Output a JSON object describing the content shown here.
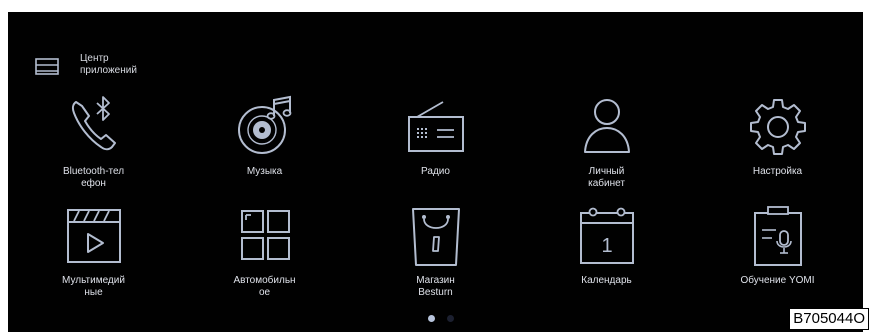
{
  "header": {
    "title": "Центр\nприложений",
    "icon": "app-center-icon"
  },
  "apps": [
    {
      "label": "Bluetooth-тел\nефон",
      "icon": "bluetooth-phone-icon"
    },
    {
      "label": "Музыка",
      "icon": "music-disc-icon"
    },
    {
      "label": "Радио",
      "icon": "radio-icon"
    },
    {
      "label": "Личный\nкабинет",
      "icon": "user-profile-icon"
    },
    {
      "label": "Настройка",
      "icon": "gear-icon"
    },
    {
      "label": "Мультимедий\nные",
      "icon": "video-clapper-icon"
    },
    {
      "label": "Автомобильн\nое",
      "icon": "grid-icon"
    },
    {
      "label": "Магазин\nBesturn",
      "icon": "shopping-bag-icon"
    },
    {
      "label": "Календарь",
      "icon": "calendar-icon",
      "day": "1"
    },
    {
      "label": "Обучение YOMI",
      "icon": "voice-assistant-icon"
    }
  ],
  "pagination": {
    "pages": 2,
    "current": 1
  },
  "image_code": "B705044O",
  "colors": {
    "background": "#010101",
    "icon_stroke": "#b3bdd0",
    "text": "#dfe2ea",
    "dot_active": "#b8c4dc",
    "dot_inactive": "#1c2030"
  }
}
